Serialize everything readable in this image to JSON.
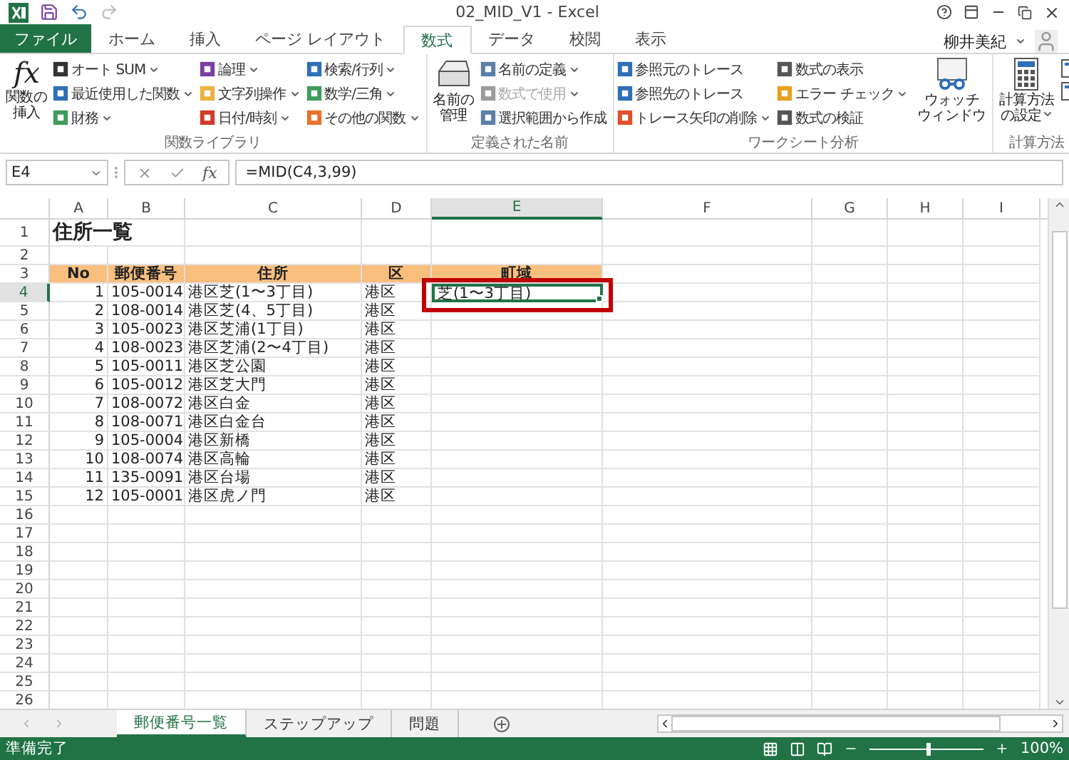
{
  "window": {
    "title": "02_MID_V1 - Excel",
    "user": "柳井美紀"
  },
  "tabs": [
    {
      "label": "ファイル",
      "kind": "file",
      "selected": false
    },
    {
      "label": "ホーム",
      "kind": "tab",
      "selected": false
    },
    {
      "label": "挿入",
      "kind": "tab",
      "selected": false
    },
    {
      "label": "ページ レイアウト",
      "kind": "tab",
      "selected": false
    },
    {
      "label": "数式",
      "kind": "tab",
      "selected": true
    },
    {
      "label": "データ",
      "kind": "tab",
      "selected": false
    },
    {
      "label": "校閲",
      "kind": "tab",
      "selected": false
    },
    {
      "label": "表示",
      "kind": "tab",
      "selected": false
    }
  ],
  "ribbon": [
    {
      "label": "関数ライブラリ",
      "columns": [
        {
          "kind": "large",
          "lines": [
            "関数の",
            "挿入"
          ],
          "glyph": "fx",
          "dropdown": false
        },
        {
          "kind": "stack",
          "items": [
            {
              "label": "オート SUM",
              "color": "#333333",
              "dropdown": true,
              "disabled": false
            },
            {
              "label": "最近使用した関数",
              "color": "#2e6fb7",
              "dropdown": true,
              "disabled": false
            },
            {
              "label": "財務",
              "color": "#3f9b5a",
              "dropdown": true,
              "disabled": false
            }
          ]
        },
        {
          "kind": "stack",
          "items": [
            {
              "label": "論理",
              "color": "#7a3fa0",
              "dropdown": true,
              "disabled": false
            },
            {
              "label": "文字列操作",
              "color": "#f0b040",
              "dropdown": true,
              "disabled": false
            },
            {
              "label": "日付/時刻",
              "color": "#d23a2a",
              "dropdown": true,
              "disabled": false
            }
          ]
        },
        {
          "kind": "stack",
          "items": [
            {
              "label": "検索/行列",
              "color": "#2e6fb7",
              "dropdown": true,
              "disabled": false
            },
            {
              "label": "数学/三角",
              "color": "#3f9b5a",
              "dropdown": true,
              "disabled": false
            },
            {
              "label": "その他の関数",
              "color": "#e8702a",
              "dropdown": true,
              "disabled": false
            }
          ]
        }
      ]
    },
    {
      "label": "定義された名前",
      "columns": [
        {
          "kind": "large",
          "lines": [
            "名前の",
            "管理"
          ],
          "dropdown": false
        },
        {
          "kind": "stack",
          "items": [
            {
              "label": "名前の定義",
              "color": "#5a7fa8",
              "dropdown": true,
              "disabled": false
            },
            {
              "label": "数式で使用",
              "color": "#9a9a9a",
              "dropdown": true,
              "disabled": true
            },
            {
              "label": "選択範囲から作成",
              "color": "#5a7fa8",
              "dropdown": false,
              "disabled": false
            }
          ]
        }
      ]
    },
    {
      "label": "ワークシート分析",
      "columns": [
        {
          "kind": "stack",
          "items": [
            {
              "label": "参照元のトレース",
              "color": "#2e6fb7",
              "dropdown": false,
              "disabled": false
            },
            {
              "label": "参照先のトレース",
              "color": "#2e6fb7",
              "dropdown": false,
              "disabled": false
            },
            {
              "label": "トレース矢印の削除",
              "color": "#e0502a",
              "dropdown": true,
              "disabled": false
            }
          ]
        },
        {
          "kind": "stack",
          "items": [
            {
              "label": "数式の表示",
              "color": "#555555",
              "dropdown": false,
              "disabled": false
            },
            {
              "label": "エラー チェック",
              "color": "#e8a020",
              "dropdown": true,
              "disabled": false
            },
            {
              "label": "数式の検証",
              "color": "#555555",
              "dropdown": false,
              "disabled": false
            }
          ]
        },
        {
          "kind": "large",
          "lines": [
            "ウォッチ",
            "ウィンドウ"
          ],
          "dropdown": false
        }
      ]
    },
    {
      "label": "計算方法",
      "columns": [
        {
          "kind": "large",
          "lines": [
            "計算方法",
            "の設定"
          ],
          "dropdown": true
        },
        {
          "kind": "icons"
        }
      ]
    }
  ],
  "formula_bar": {
    "name_box": "E4",
    "function_button": "fx",
    "formula": "=MID(C4,3,99)"
  },
  "sheet": {
    "callout_on_active_cell": true,
    "columns": [
      {
        "label": "A",
        "selected": false
      },
      {
        "label": "B",
        "selected": false
      },
      {
        "label": "C",
        "selected": false
      },
      {
        "label": "D",
        "selected": false
      },
      {
        "label": "E",
        "selected": true
      },
      {
        "label": "F",
        "selected": false
      },
      {
        "label": "G",
        "selected": false
      },
      {
        "label": "H",
        "selected": false
      },
      {
        "label": "I",
        "selected": false
      }
    ],
    "rows": [
      {
        "label": "1",
        "kind": "title",
        "selected": false,
        "cells": {
          "A": "住所一覧"
        }
      },
      {
        "label": "2",
        "kind": "data",
        "selected": false,
        "cells": {}
      },
      {
        "label": "3",
        "kind": "header",
        "selected": false,
        "cells": {
          "A": "No",
          "B": "郵便番号",
          "C": "住所",
          "D": "区",
          "E": "町域"
        }
      },
      {
        "label": "4",
        "kind": "data",
        "selected": true,
        "cells": {
          "A": "1",
          "B": "105-0014",
          "C": "港区芝(1〜3丁目)",
          "D": "港区",
          "E": "芝(1〜3丁目)"
        }
      },
      {
        "label": "5",
        "kind": "data",
        "selected": false,
        "cells": {
          "A": "2",
          "B": "108-0014",
          "C": "港区芝(4、5丁目)",
          "D": "港区"
        }
      },
      {
        "label": "6",
        "kind": "data",
        "selected": false,
        "cells": {
          "A": "3",
          "B": "105-0023",
          "C": "港区芝浦(1丁目)",
          "D": "港区"
        }
      },
      {
        "label": "7",
        "kind": "data",
        "selected": false,
        "cells": {
          "A": "4",
          "B": "108-0023",
          "C": "港区芝浦(2〜4丁目)",
          "D": "港区"
        }
      },
      {
        "label": "8",
        "kind": "data",
        "selected": false,
        "cells": {
          "A": "5",
          "B": "105-0011",
          "C": "港区芝公園",
          "D": "港区"
        }
      },
      {
        "label": "9",
        "kind": "data",
        "selected": false,
        "cells": {
          "A": "6",
          "B": "105-0012",
          "C": "港区芝大門",
          "D": "港区"
        }
      },
      {
        "label": "10",
        "kind": "data",
        "selected": false,
        "cells": {
          "A": "7",
          "B": "108-0072",
          "C": "港区白金",
          "D": "港区"
        }
      },
      {
        "label": "11",
        "kind": "data",
        "selected": false,
        "cells": {
          "A": "8",
          "B": "108-0071",
          "C": "港区白金台",
          "D": "港区"
        }
      },
      {
        "label": "12",
        "kind": "data",
        "selected": false,
        "cells": {
          "A": "9",
          "B": "105-0004",
          "C": "港区新橋",
          "D": "港区"
        }
      },
      {
        "label": "13",
        "kind": "data",
        "selected": false,
        "cells": {
          "A": "10",
          "B": "108-0074",
          "C": "港区高輪",
          "D": "港区"
        }
      },
      {
        "label": "14",
        "kind": "data",
        "selected": false,
        "cells": {
          "A": "11",
          "B": "135-0091",
          "C": "港区台場",
          "D": "港区"
        }
      },
      {
        "label": "15",
        "kind": "data",
        "selected": false,
        "cells": {
          "A": "12",
          "B": "105-0001",
          "C": "港区虎ノ門",
          "D": "港区"
        }
      },
      {
        "label": "16",
        "kind": "data",
        "selected": false,
        "cells": {}
      },
      {
        "label": "17",
        "kind": "data",
        "selected": false,
        "cells": {}
      },
      {
        "label": "18",
        "kind": "data",
        "selected": false,
        "cells": {}
      },
      {
        "label": "19",
        "kind": "data",
        "selected": false,
        "cells": {}
      },
      {
        "label": "20",
        "kind": "data",
        "selected": false,
        "cells": {}
      },
      {
        "label": "21",
        "kind": "data",
        "selected": false,
        "cells": {}
      },
      {
        "label": "22",
        "kind": "data",
        "selected": false,
        "cells": {}
      },
      {
        "label": "23",
        "kind": "data",
        "selected": false,
        "cells": {}
      },
      {
        "label": "24",
        "kind": "data",
        "selected": false,
        "cells": {}
      },
      {
        "label": "25",
        "kind": "data",
        "selected": false,
        "cells": {}
      },
      {
        "label": "26",
        "kind": "data",
        "selected": false,
        "cells": {}
      }
    ]
  },
  "sheet_tabs": [
    {
      "label": "郵便番号一覧",
      "selected": true
    },
    {
      "label": "ステップアップ",
      "selected": false
    },
    {
      "label": "問題",
      "selected": false
    }
  ],
  "status_bar": {
    "status": "準備完了",
    "zoom": "100%",
    "level": 0.5
  }
}
